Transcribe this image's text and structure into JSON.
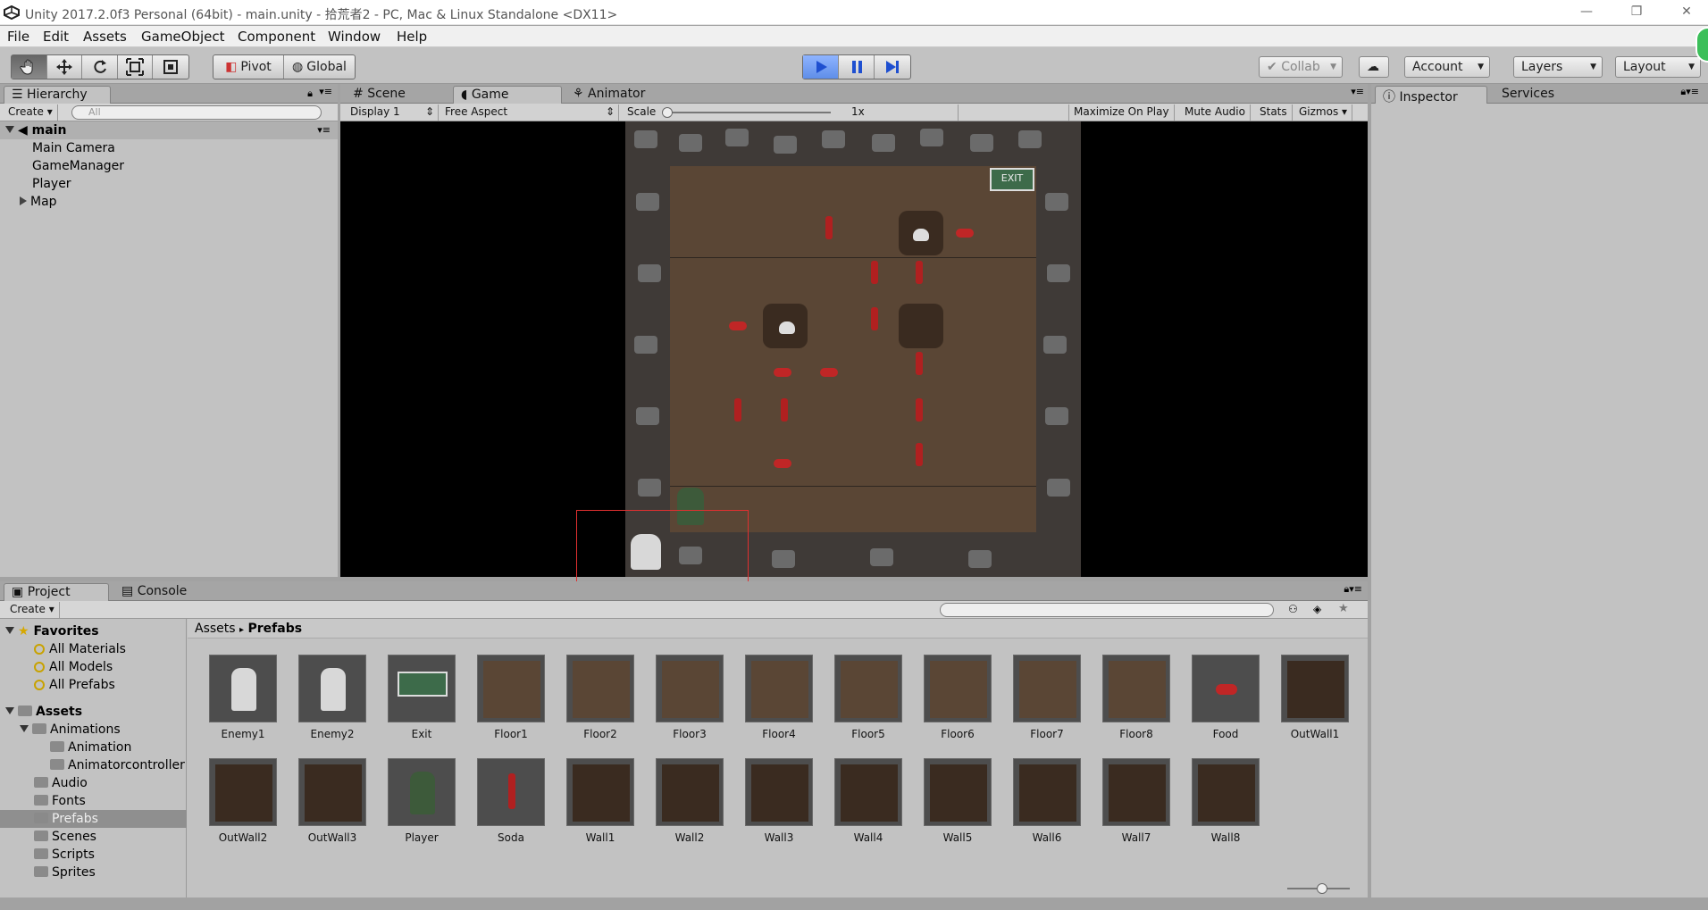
{
  "window": {
    "title": "Unity 2017.2.0f3 Personal (64bit) - main.unity - 拾荒者2 - PC, Mac & Linux Standalone <DX11>"
  },
  "menu": [
    "File",
    "Edit",
    "Assets",
    "GameObject",
    "Component",
    "Window",
    "Help"
  ],
  "toolbar": {
    "pivot": "Pivot",
    "global": "Global",
    "collab": "Collab",
    "account": "Account",
    "layers": "Layers",
    "layout": "Layout"
  },
  "hierarchy": {
    "tab": "Hierarchy",
    "create": "Create",
    "search_placeholder": "All",
    "scene": "main",
    "items": [
      "Main Camera",
      "GameManager",
      "Player",
      "Map"
    ]
  },
  "view_tabs": {
    "scene": "Scene",
    "game": "Game",
    "animator": "Animator"
  },
  "game_bar": {
    "display": "Display 1",
    "aspect": "Free Aspect",
    "scale_label": "Scale",
    "scale_value": "1x",
    "maximize": "Maximize On Play",
    "mute": "Mute Audio",
    "stats": "Stats",
    "gizmos": "Gizmos"
  },
  "sign_text": "EXIT",
  "inspector": {
    "tab": "Inspector",
    "services": "Services"
  },
  "project": {
    "tab": "Project",
    "console": "Console",
    "create": "Create",
    "breadcrumb_root": "Assets",
    "breadcrumb_current": "Prefabs",
    "favorites": {
      "label": "Favorites",
      "items": [
        "All Materials",
        "All Models",
        "All Prefabs"
      ]
    },
    "assets": {
      "label": "Assets",
      "animations": "Animations",
      "anim_children": [
        "Animation",
        "Animatorcontroller"
      ],
      "folders": [
        "Audio",
        "Fonts",
        "Prefabs",
        "Scenes",
        "Scripts",
        "Sprites"
      ]
    },
    "prefabs": [
      "Enemy1",
      "Enemy2",
      "Exit",
      "Floor1",
      "Floor2",
      "Floor3",
      "Floor4",
      "Floor5",
      "Floor6",
      "Floor7",
      "Floor8",
      "Food",
      "OutWall1",
      "OutWall2",
      "OutWall3",
      "Player",
      "Soda",
      "Wall1",
      "Wall2",
      "Wall3",
      "Wall4",
      "Wall5",
      "Wall6",
      "Wall7",
      "Wall8"
    ]
  },
  "colors": {
    "accent_play": "#4f7fe0",
    "selection": "#8f8f8f",
    "game_bg": "#000000",
    "floor": "#5a4635",
    "selection_box": "#e03030"
  }
}
